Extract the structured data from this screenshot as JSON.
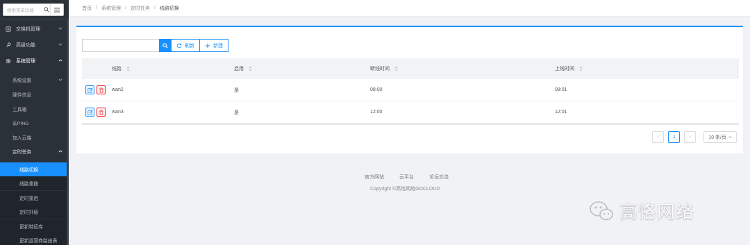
{
  "sidebar": {
    "search_placeholder": "搜索菜单功能",
    "menu": [
      {
        "label": "交换机管理",
        "icon": "switch-icon"
      },
      {
        "label": "高级功能",
        "icon": "plug-icon"
      },
      {
        "label": "系统管理",
        "icon": "gear-icon"
      }
    ],
    "sub_items": [
      {
        "label": "系统设置"
      },
      {
        "label": "硬件信息"
      },
      {
        "label": "工具箱"
      },
      {
        "label": "长PING"
      },
      {
        "label": "加入云端"
      },
      {
        "label": "定时任务"
      }
    ],
    "task_items": [
      {
        "label": "线路切换",
        "active": true
      },
      {
        "label": "线路重拨"
      },
      {
        "label": "定时重启"
      },
      {
        "label": "定时升级"
      },
      {
        "label": "更新特征库"
      },
      {
        "label": "更新运营商路由表"
      }
    ]
  },
  "breadcrumb": [
    "首页",
    "系统管理",
    "定时任务",
    "线路切换"
  ],
  "toolbar": {
    "search_value": "",
    "refresh_label": "刷新",
    "new_label": "新建"
  },
  "table": {
    "headers": {
      "line": "线路",
      "enabled": "启用",
      "offline_time": "断线时间",
      "online_time": "上线时间"
    },
    "rows": [
      {
        "line": "wan2",
        "enabled": "是",
        "offline_time": "08:00",
        "online_time": "08:01"
      },
      {
        "line": "wan3",
        "enabled": "是",
        "offline_time": "12:00",
        "online_time": "12:01"
      }
    ]
  },
  "pagination": {
    "prev": "‹",
    "current_page": "1",
    "next": "›",
    "page_size": "10 条/页"
  },
  "footer": {
    "links": [
      "官方网站",
      "云平台",
      "论坛交流"
    ],
    "copyright_prefix": "Copyright",
    "copyright_symbol": "©",
    "copyright_owner": "高恪网络GOCLOUD"
  },
  "watermark": {
    "text": "高恪网络"
  },
  "colors": {
    "accent": "#1890ff",
    "sidebar_bg": "#2b3138",
    "danger": "#f5222d"
  }
}
